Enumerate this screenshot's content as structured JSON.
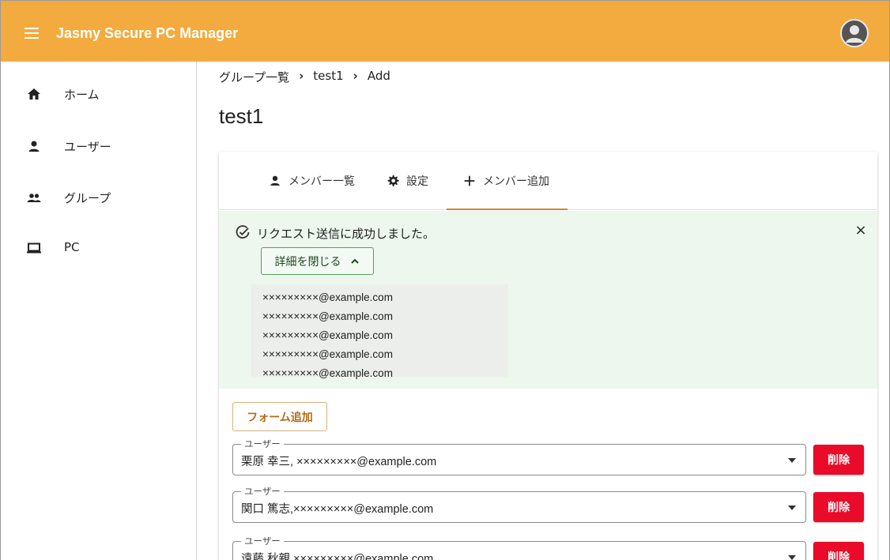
{
  "app": {
    "title": "Jasmy Secure PC Manager"
  },
  "sidebar": {
    "items": [
      {
        "label": "ホーム",
        "icon": "home-icon"
      },
      {
        "label": "ユーザー",
        "icon": "person-icon"
      },
      {
        "label": "グループ",
        "icon": "group-icon"
      },
      {
        "label": "PC",
        "icon": "laptop-icon"
      }
    ]
  },
  "breadcrumb": {
    "items": [
      "グループ一覧",
      "test1",
      "Add"
    ],
    "separator": "›"
  },
  "page": {
    "title": "test1"
  },
  "tabs": [
    {
      "label": "メンバー一覧",
      "icon": "person-icon"
    },
    {
      "label": "設定",
      "icon": "gear-icon"
    },
    {
      "label": "メンバー追加",
      "icon": "plus-icon"
    }
  ],
  "alert": {
    "message": "リクエスト送信に成功しました。",
    "close": "×",
    "detail_button": "詳細を閉じる",
    "emails": [
      "×××××××××@example.com",
      "×××××××××@example.com",
      "×××××××××@example.com",
      "×××××××××@example.com",
      "×××××××××@example.com"
    ]
  },
  "form": {
    "add_button": "フォーム追加",
    "field_label": "ユーザー",
    "delete_label": "削除",
    "rows": [
      {
        "value": "栗原 幸三, ×××××××××@example.com"
      },
      {
        "value": "関口 篤志,×××××××××@example.com"
      },
      {
        "value": "遠藤 秋親,×××××××××@example.com"
      }
    ]
  },
  "colors": {
    "appbar": "#f3ab3f",
    "alert_bg": "#edf7ed",
    "tab_indicator": "#c98a2f",
    "delete": "#ea0a2a"
  }
}
